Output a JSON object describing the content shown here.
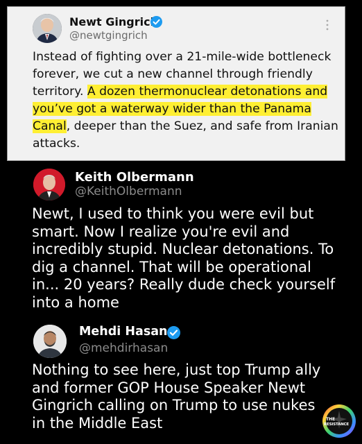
{
  "tweets": [
    {
      "name": "Newt Gingrich",
      "handle": "@newtgingrich",
      "verified": true,
      "body_plain": "Instead of fighting over a 21-mile-wide bottleneck forever, we cut a new channel through friendly territory. ",
      "body_highlight": "A dozen thermonuclear detonations and you’ve got a waterway wider than the Panama Canal",
      "body_end": ", deeper than the Suez, and safe from Iranian attacks.",
      "highlight_color": "#ffef33"
    },
    {
      "name": "Keith Olbermann",
      "handle": "@KeithOlbermann",
      "verified": false,
      "body": "Newt, I used to think you were evil but smart. Now I realize you're evil and incredibly stupid. Nuclear detonations. To dig a channel. That will be operational in... 20 years? Really dude check yourself into a home"
    },
    {
      "name": "Mehdi Hasan",
      "handle": "@mehdirhasan",
      "verified": true,
      "body": "Nothing to see here, just top Trump ally and former GOP House Speaker Newt Gingrich calling on Trump to use nukes in the Middle East"
    }
  ],
  "watermark": {
    "line1": "THE",
    "line2": "RESISTANCE"
  },
  "colors": {
    "verified_blue": "#1d9bf0",
    "background": "#000000",
    "card": "#f1f1f1"
  }
}
